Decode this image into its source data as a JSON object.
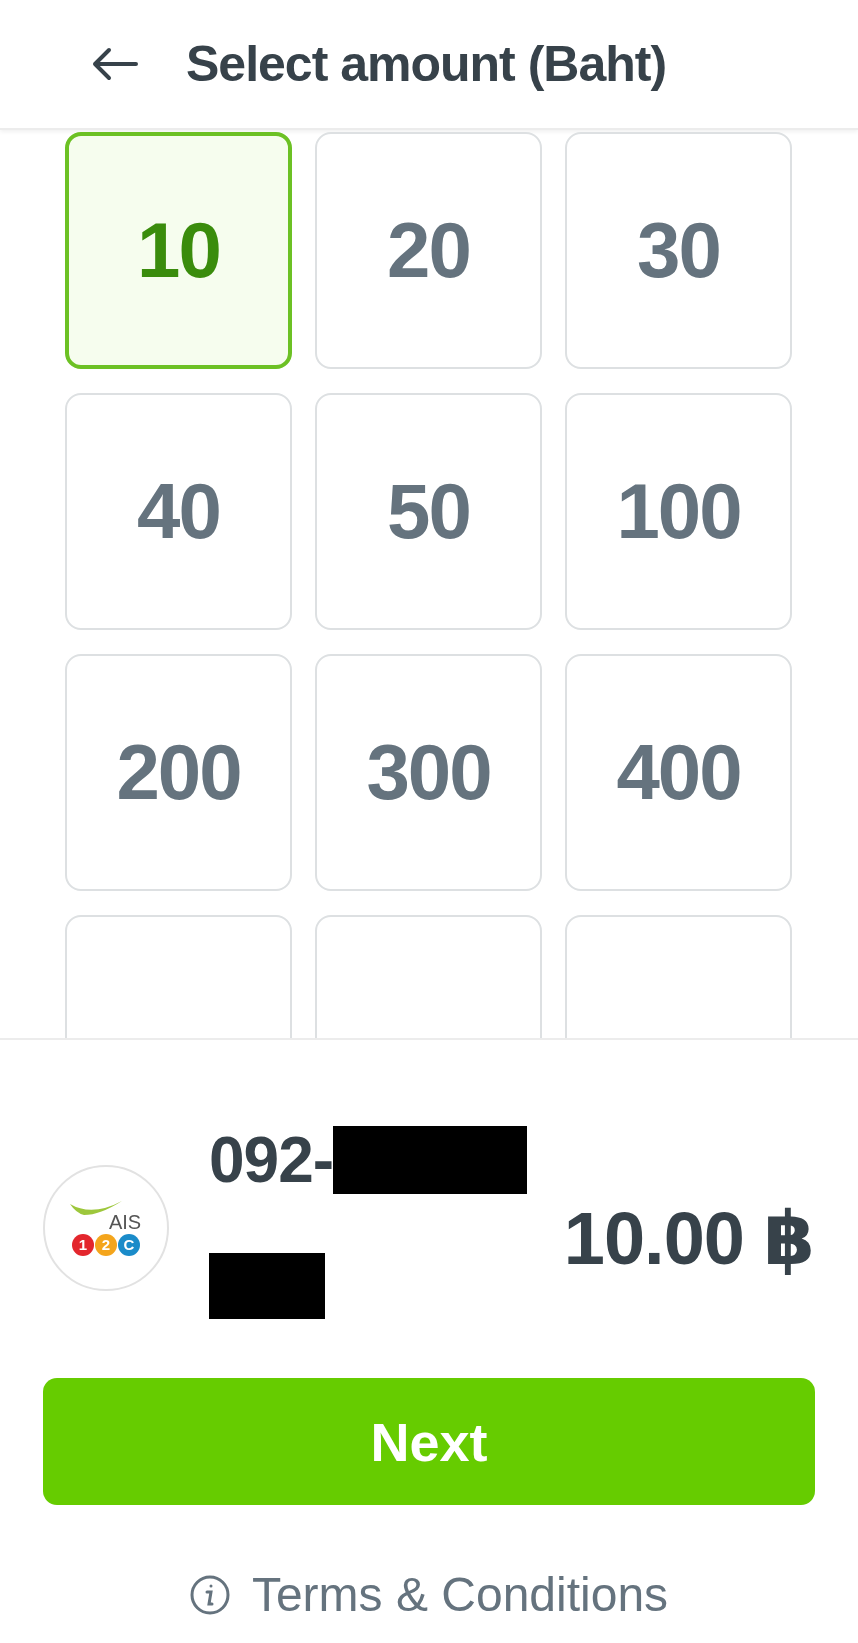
{
  "header": {
    "title": "Select amount (Baht)"
  },
  "amounts": [
    {
      "label": "10",
      "selected": true
    },
    {
      "label": "20",
      "selected": false
    },
    {
      "label": "30",
      "selected": false
    },
    {
      "label": "40",
      "selected": false
    },
    {
      "label": "50",
      "selected": false
    },
    {
      "label": "100",
      "selected": false
    },
    {
      "label": "200",
      "selected": false
    },
    {
      "label": "300",
      "selected": false
    },
    {
      "label": "400",
      "selected": false
    },
    {
      "selected": false
    },
    {
      "selected": false
    },
    {
      "selected": false
    }
  ],
  "summary": {
    "logo": {
      "wordmark": "AIS",
      "badges": [
        {
          "text": "1",
          "color": "#e3262d"
        },
        {
          "text": "2",
          "color": "#f4a51c"
        },
        {
          "text": "C",
          "color": "#1a8bc9"
        }
      ]
    },
    "phone": "092-",
    "total": "10.00 ฿"
  },
  "next_button": "Next",
  "terms_link": "Terms & Conditions"
}
